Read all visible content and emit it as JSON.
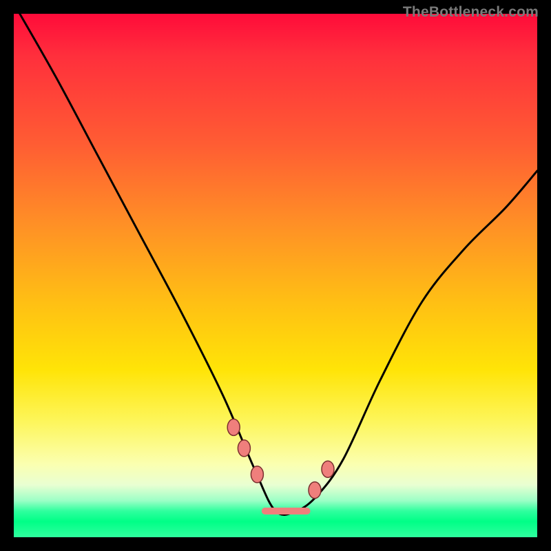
{
  "watermark": "TheBottleneck.com",
  "chart_data": {
    "type": "line",
    "title": "",
    "xlabel": "",
    "ylabel": "",
    "xlim": [
      0,
      100
    ],
    "ylim": [
      0,
      100
    ],
    "series": [
      {
        "name": "bottleneck-curve",
        "x": [
          0,
          8,
          16,
          24,
          32,
          40,
          46,
          50,
          54,
          58,
          63,
          70,
          78,
          86,
          94,
          100
        ],
        "y": [
          102,
          88,
          73,
          58,
          43,
          27,
          13,
          5,
          5,
          8,
          15,
          30,
          45,
          55,
          63,
          70
        ]
      }
    ],
    "markers": [
      {
        "name": "left-shoulder-upper",
        "x": 42,
        "y": 21
      },
      {
        "name": "left-shoulder-lower",
        "x": 44,
        "y": 17
      },
      {
        "name": "left-knee",
        "x": 46.5,
        "y": 12
      },
      {
        "name": "right-knee",
        "x": 57.5,
        "y": 9
      },
      {
        "name": "right-shoulder",
        "x": 60,
        "y": 13
      }
    ],
    "trough": {
      "x_start": 48,
      "x_end": 56,
      "y": 5
    }
  }
}
